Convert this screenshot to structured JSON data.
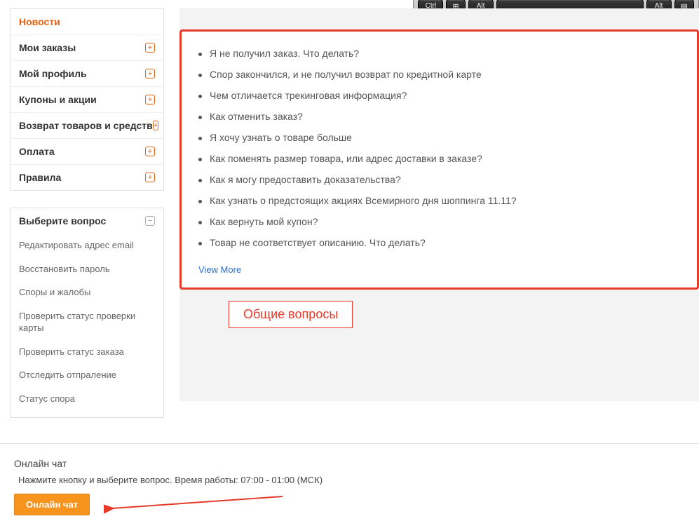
{
  "keyboard": {
    "ctrl": "Ctrl",
    "win": "⊞",
    "alt1": "Alt",
    "space": " ",
    "alt2": "Alt",
    "menu": "▤"
  },
  "sidebar": {
    "nav": [
      {
        "label": "Новости",
        "active": true
      },
      {
        "label": "Мои заказы"
      },
      {
        "label": "Мой профиль"
      },
      {
        "label": "Купоны и акции"
      },
      {
        "label": "Возврат товаров и средств"
      },
      {
        "label": "Оплата"
      },
      {
        "label": "Правила"
      }
    ],
    "questions_header": "Выберите вопрос",
    "questions": [
      "Редактировать адрес email",
      "Восстановить пароль",
      "Споры и жалобы",
      "Проверить статус проверки карты",
      "Проверить статус заказа",
      "Отследить отпраление",
      "Статус спора"
    ]
  },
  "faq": {
    "items": [
      "Я не получил заказ. Что делать?",
      "Спор закончился, и не получил возврат по кредитной карте",
      "Чем отличается трекинговая информация?",
      "Как отменить заказ?",
      "Я хочу узнать о товаре больше",
      "Как поменять размер товара, или адрес доставки в заказе?",
      "Как я могу предоставить доказательства?",
      "Как узнать о предстоящих акциях Всемирного дня шоппинга 11.11?",
      "Как вернуть мой купон?",
      "Товар не соответствует описанию. Что делать?"
    ],
    "view_more": "View More"
  },
  "annotation": "Общие вопросы",
  "chat": {
    "title": "Онлайн чат",
    "desc": "Нажмите кнопку и выберите вопрос. Время работы: 07:00 - 01:00 (МСК)",
    "button": "Онлайн чат"
  }
}
